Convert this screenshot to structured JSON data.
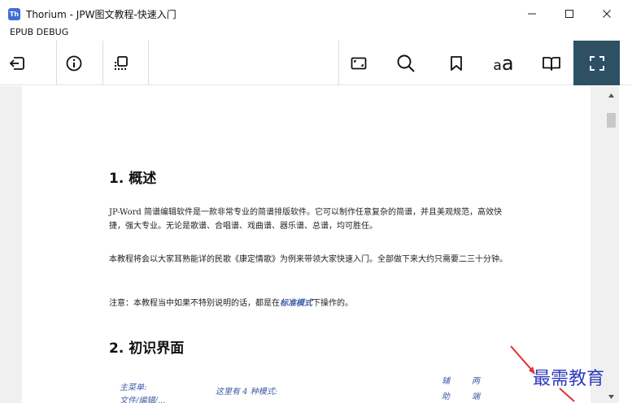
{
  "window": {
    "app_icon_text": "Th",
    "title": "Thorium - JPW图文教程-快速入门",
    "minimize_icon": "minimize-icon",
    "maximize_icon": "maximize-icon",
    "close_icon": "close-icon"
  },
  "menu": {
    "items": [
      "EPUB DEBUG"
    ]
  },
  "toolbar": {
    "left": [
      "back-icon",
      "info-icon",
      "table-of-contents-icon"
    ],
    "right": [
      "fit-screen-icon",
      "search-icon",
      "bookmark-icon",
      "text-settings-icon",
      "book-icon",
      "fullscreen-icon"
    ],
    "text_settings": {
      "small": "a",
      "big": "a"
    },
    "active_color": "#2d5063"
  },
  "content": {
    "sections": [
      {
        "heading": "1. 概述"
      },
      {
        "heading": "2. 初识界面"
      }
    ],
    "paragraphs": {
      "p1": "JP-Word 简谱编辑软件是一款非常专业的简谱排版软件。它可以制作任意复杂的简谱，并且美观规范，高效快捷，强大专业。无论是歌谱、合唱谱、戏曲谱、器乐谱、总谱，均可胜任。",
      "p2": "本教程将会以大家耳熟能详的民歌《康定情歌》为例来带领大家快速入门。全部做下来大约只需要二三十分钟。",
      "p3_before": "注意：本教程当中如果不特别说明的话，都是在",
      "p3_em": "标准模式",
      "p3_after": "下操作的。"
    },
    "figure_labels": {
      "main_menu": "主菜单:",
      "main_menu_sub": "文件/编辑/...",
      "modes": "这里有 4 种模式:",
      "col1_top": "辅",
      "col1_bottom": "助",
      "col2_top": "两",
      "col2_bottom": "端"
    }
  },
  "watermark": {
    "text": "最需教育"
  }
}
